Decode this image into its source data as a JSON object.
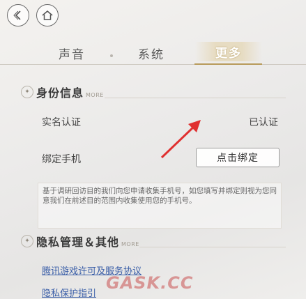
{
  "tabs": [
    {
      "label": "声音"
    },
    {
      "label": "系统"
    },
    {
      "label": "更多",
      "active": true
    }
  ],
  "identity": {
    "title": "身份信息",
    "subtitle": "MORE",
    "realname_label": "实名认证",
    "realname_value": "已认证",
    "phone_label": "绑定手机",
    "bind_button": "点击绑定",
    "note": "基于调研回访目的我们向您申请收集手机号，如您填写并绑定则视为您同意我们在前述目的范围内收集使用您的手机号。"
  },
  "privacy": {
    "title": "隐私管理＆其他",
    "subtitle": "MORE",
    "links": [
      "腾讯游戏许可及服务协议",
      "隐私保护指引"
    ]
  },
  "watermark": "GASK.CC",
  "colors": {
    "accent": "#b89a5a",
    "link": "#3b5fa8",
    "arrow": "#e03030"
  }
}
